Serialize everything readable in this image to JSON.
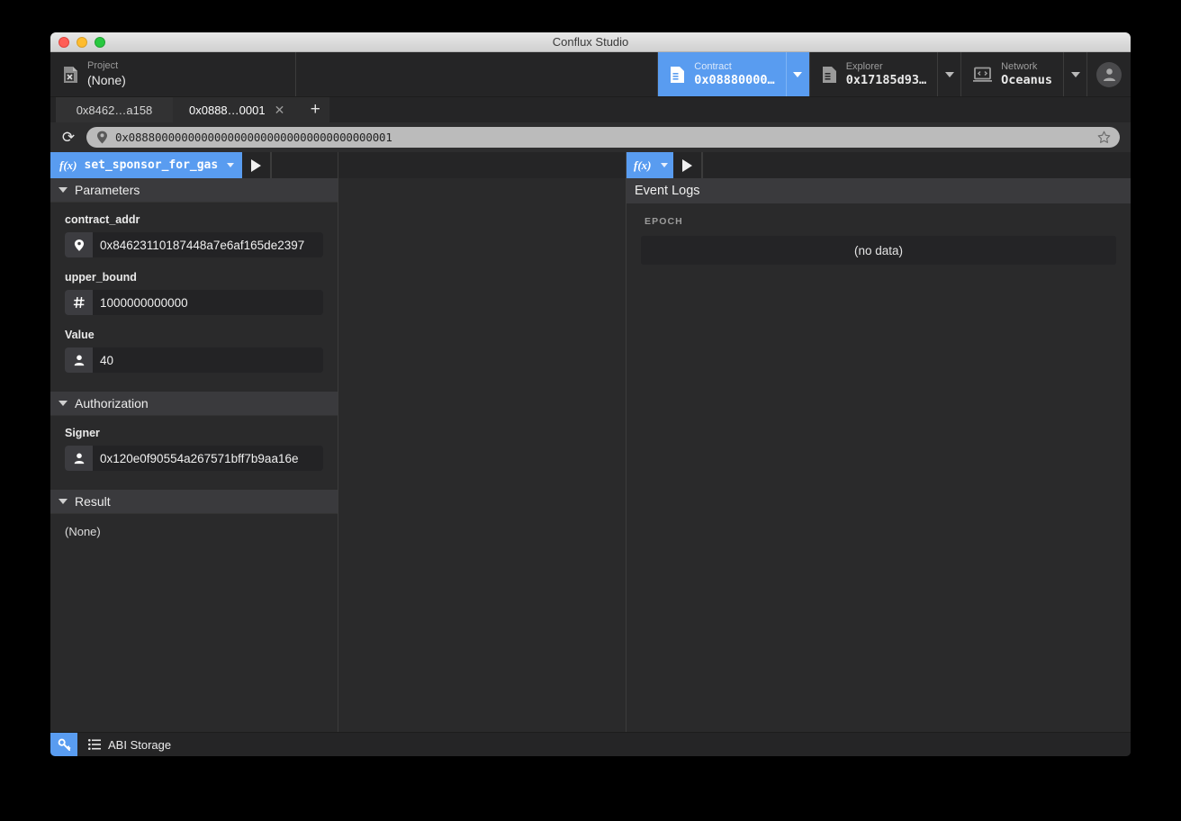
{
  "window": {
    "title": "Conflux Studio"
  },
  "topbar": {
    "project": {
      "label": "Project",
      "value": "(None)",
      "icon": "file-x-icon"
    },
    "buttons": [
      {
        "label": "Contract",
        "value": "0x08880000…",
        "icon": "contract-icon",
        "active": true
      },
      {
        "label": "Explorer",
        "value": "0x17185d93…",
        "icon": "explorer-icon",
        "active": false
      },
      {
        "label": "Network",
        "value": "Oceanus",
        "icon": "network-icon",
        "active": false
      }
    ],
    "account_icon": "user-avatar-icon"
  },
  "tabs": {
    "items": [
      {
        "label": "0x8462…a158",
        "active": false,
        "closable": false
      },
      {
        "label": "0x0888…0001",
        "active": true,
        "closable": true,
        "close_glyph": "✕"
      }
    ],
    "add_glyph": "+"
  },
  "addressbar": {
    "reload_glyph": "⟳",
    "location_icon": "map-pin-icon",
    "url": "0x0888000000000000000000000000000000000001",
    "bookmark_icon": "star-icon"
  },
  "left_pane": {
    "function_bar": {
      "function_icon": "fx-icon",
      "function_name": "set_sponsor_for_gas",
      "run_icon": "play-icon"
    },
    "parameters": {
      "title": "Parameters",
      "fields": [
        {
          "label": "contract_addr",
          "value": "0x84623110187448a7e6af165de2397",
          "icon": "map-pin-icon"
        },
        {
          "label": "upper_bound",
          "value": "1000000000000",
          "icon": "hash-icon"
        },
        {
          "label": "Value",
          "value": "40",
          "icon": "user-icon"
        }
      ]
    },
    "authorization": {
      "title": "Authorization",
      "fields": [
        {
          "label": "Signer",
          "value": "0x120e0f90554a267571bff7b9aa16e",
          "icon": "user-icon"
        }
      ]
    },
    "result": {
      "title": "Result",
      "value": "(None)"
    }
  },
  "right_pane": {
    "function_bar": {
      "function_icon": "fx-icon",
      "run_icon": "play-icon"
    },
    "title": "Event Logs",
    "columns": [
      "EPOCH"
    ],
    "empty_message": "(no data)"
  },
  "statusbar": {
    "key_icon": "key-icon",
    "list_icon": "list-icon",
    "abi_storage_label": "ABI Storage"
  },
  "colors": {
    "accent": "#599cf0",
    "window_bg": "#2a2a2b",
    "toolbar_bg": "#252526",
    "section_header_bg": "#3a3a3d",
    "input_bg": "#232325"
  }
}
